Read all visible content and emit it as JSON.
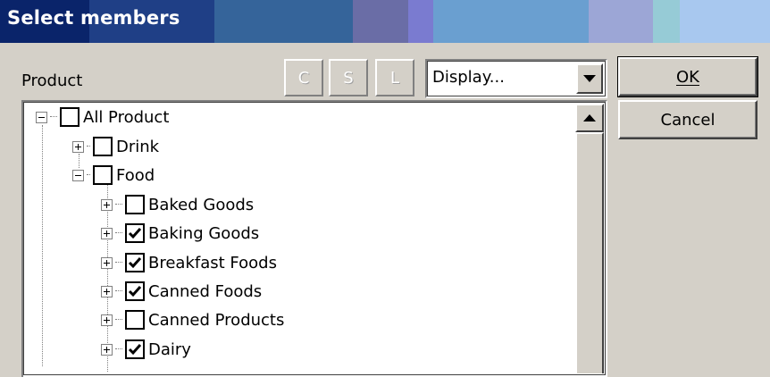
{
  "window": {
    "title": "Select members",
    "titlebar_colors": [
      "#0a246a",
      "#1f3f86",
      "#35649a",
      "#3e6ba2",
      "#6a6da6",
      "#7a7bd0",
      "#6a9fd0",
      "#79a9d9",
      "#9ca6d6",
      "#a7c5e6",
      "#96cbd6",
      "#a8c8ef"
    ]
  },
  "dimension": {
    "label": "Product"
  },
  "toolbar": {
    "buttons": [
      {
        "label": "C"
      },
      {
        "label": "S"
      },
      {
        "label": "L"
      }
    ],
    "display_select": {
      "value": "Display..."
    }
  },
  "actions": {
    "ok_label": "OK",
    "cancel_label": "Cancel"
  },
  "tree": {
    "nodes": [
      {
        "label": "All Product",
        "checked": false,
        "expanded": true
      },
      {
        "label": "Drink",
        "checked": false,
        "expanded": false
      },
      {
        "label": "Food",
        "checked": false,
        "expanded": true
      },
      {
        "label": "Baked Goods",
        "checked": false,
        "expanded": false
      },
      {
        "label": "Baking Goods",
        "checked": true,
        "expanded": false
      },
      {
        "label": "Breakfast Foods",
        "checked": true,
        "expanded": false
      },
      {
        "label": "Canned Foods",
        "checked": true,
        "expanded": false
      },
      {
        "label": "Canned Products",
        "checked": false,
        "expanded": false
      },
      {
        "label": "Dairy",
        "checked": true,
        "expanded": false
      }
    ]
  }
}
